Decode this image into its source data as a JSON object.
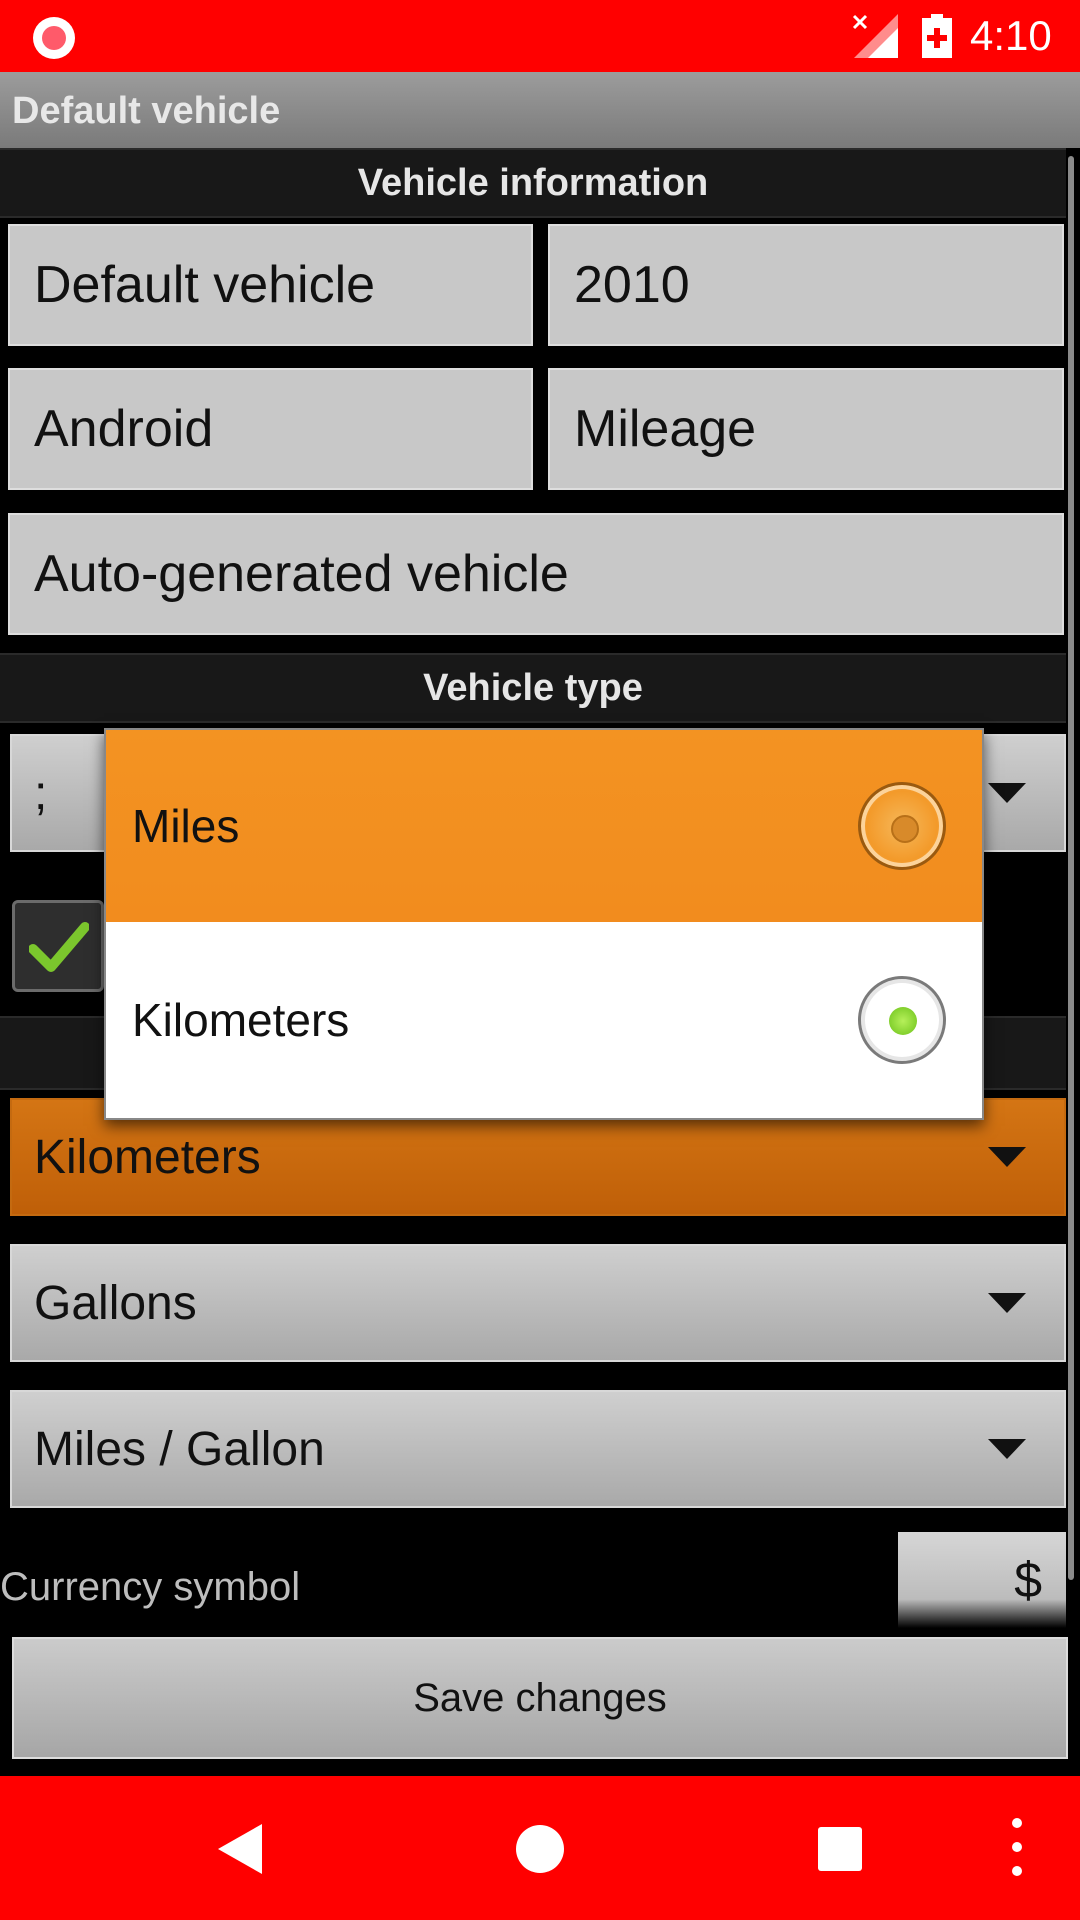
{
  "status_bar": {
    "time": "4:10"
  },
  "action_bar": {
    "title": "Default vehicle"
  },
  "vehicle_information": {
    "header": "Vehicle information",
    "name": "Default vehicle",
    "year": "2010",
    "make": "Android",
    "model": "Mileage",
    "description": "Auto-generated vehicle"
  },
  "vehicle_type": {
    "header": "Vehicle type",
    "spinner_value": ";"
  },
  "units": {
    "distance": "Kilometers",
    "volume": "Gallons",
    "economy": "Miles / Gallon"
  },
  "currency": {
    "label": "Currency symbol",
    "value": "$"
  },
  "save_button": "Save changes",
  "dropdown": {
    "options": [
      {
        "label": "Miles",
        "checked": false
      },
      {
        "label": "Kilometers",
        "checked": true
      }
    ]
  },
  "colors": {
    "status_bar": "#ff0000",
    "accent": "#f39322",
    "selected_radio": "#7ed321"
  }
}
